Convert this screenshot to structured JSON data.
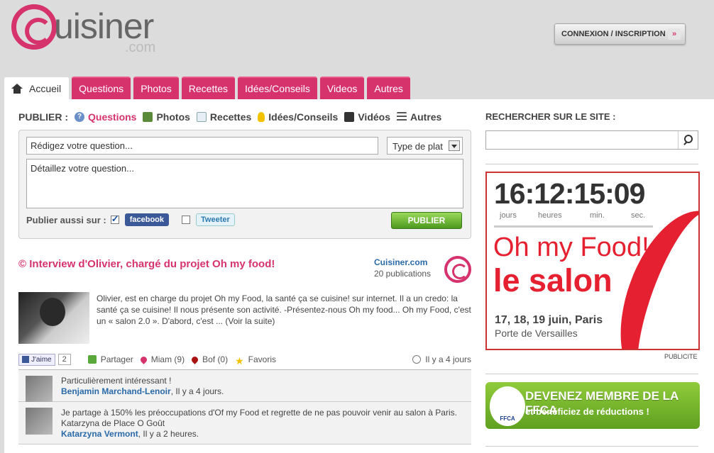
{
  "header": {
    "logo_text": "uisiner",
    "logo_com": ".com",
    "login_label": "CONNEXION / INSCRIPTION",
    "login_arrow": "»"
  },
  "nav": {
    "tabs": [
      {
        "label": "Accueil"
      },
      {
        "label": "Questions"
      },
      {
        "label": "Photos"
      },
      {
        "label": "Recettes"
      },
      {
        "label": "Idées/Conseils"
      },
      {
        "label": "Videos"
      },
      {
        "label": "Autres"
      }
    ]
  },
  "publish": {
    "label": "PUBLIER :",
    "items": [
      {
        "label": "Questions",
        "icon": "question-icon"
      },
      {
        "label": "Photos",
        "icon": "photo-icon"
      },
      {
        "label": "Recettes",
        "icon": "recipe-icon"
      },
      {
        "label": "Idées/Conseils",
        "icon": "lightbulb-icon"
      },
      {
        "label": "Vidéos",
        "icon": "video-icon"
      },
      {
        "label": "Autres",
        "icon": "list-icon"
      }
    ],
    "question_placeholder": "Rédigez votre question...",
    "type_select": "Type de plat",
    "detail_placeholder": "Détaillez votre question...",
    "also_label": "Publier aussi sur :",
    "facebook": "facebook",
    "twitter": "Tweeter",
    "submit": "PUBLIER"
  },
  "article": {
    "title": "Interview d'Olivier, chargé du projet Oh my food!",
    "source_name": "Cuisiner.com",
    "source_pubs": "20 publications",
    "text": "Olivier, est en charge du projet Oh my Food, la santé ça se cuisine! sur internet. Il a un credo: la santé ça se cuisine! Il nous présente son activité. -Présentez-nous Oh my food... Oh my Food, c'est un « salon 2.0 ». D'abord, c'est ...",
    "read_more": "(Voir la suite)",
    "like_label": "J'aime",
    "like_count": "2",
    "share": "Partager",
    "miam": "Miam (9)",
    "bof": "Bof (0)",
    "favoris": "Favoris",
    "time": "Il y a 4 jours"
  },
  "comments": [
    {
      "text": "Particulièrement intéressant !",
      "author": "Benjamin Marchand-Lenoir",
      "time": ", Il y a 4 jours."
    },
    {
      "text": "Je partage à 150% les préoccupations d'Of my Food et regrette de ne pas pouvoir venir au salon à Paris. Katarzyna de Place O Goût",
      "author": "Katarzyna Vermont",
      "time": ", Il y a 2 heures."
    }
  ],
  "sidebar": {
    "search_label": "RECHERCHER SUR LE SITE :",
    "ad": {
      "counter": "16:12:15:09",
      "units": [
        "jours",
        "heures",
        "min.",
        "sec."
      ],
      "title1": "Oh my Food!",
      "title2": "le salon",
      "date": "17, 18, 19 juin, Paris",
      "place": "Porte de Versailles"
    },
    "pub_label": "PUBLICITE",
    "ffca_title": "DEVENEZ MEMBRE DE LA FFCA",
    "ffca_sub": "et bénéficiez de réductions !"
  }
}
